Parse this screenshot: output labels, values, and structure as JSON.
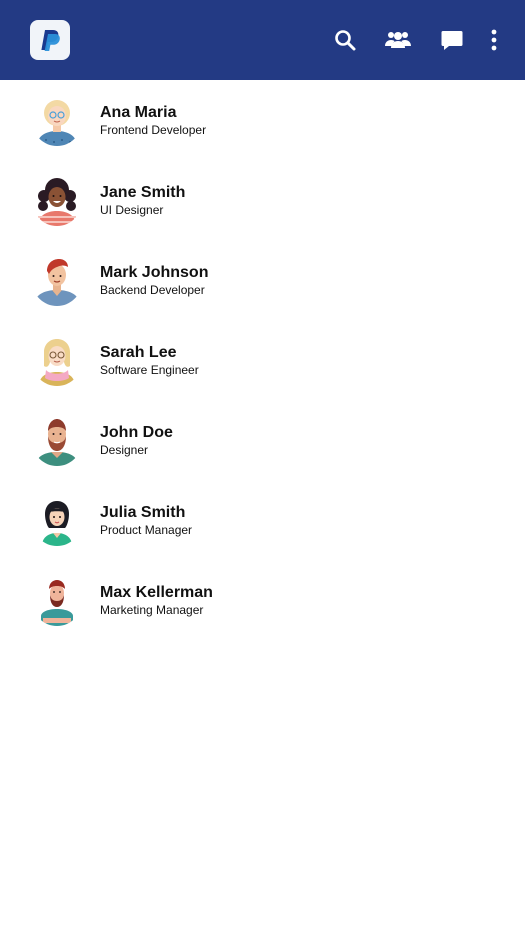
{
  "header": {
    "logo_icon": "paypal-logo-icon",
    "icons": [
      "search-icon",
      "people-icon",
      "chat-icon",
      "more-vert-icon"
    ],
    "background": "#233a84"
  },
  "contacts": [
    {
      "name": "Ana Maria",
      "role": "Frontend Developer",
      "avatar_icon": "avatar-blonde-woman-glasses-icon"
    },
    {
      "name": "Jane Smith",
      "role": "UI Designer",
      "avatar_icon": "avatar-curly-hair-woman-icon"
    },
    {
      "name": "Mark Johnson",
      "role": "Backend Developer",
      "avatar_icon": "avatar-redhead-man-icon"
    },
    {
      "name": "Sarah Lee",
      "role": "Software Engineer",
      "avatar_icon": "avatar-blonde-woman-scarf-icon"
    },
    {
      "name": "John Doe",
      "role": "Designer",
      "avatar_icon": "avatar-bearded-man-icon"
    },
    {
      "name": "Julia Smith",
      "role": "Product Manager",
      "avatar_icon": "avatar-dark-hair-woman-icon"
    },
    {
      "name": "Max Kellerman",
      "role": "Marketing Manager",
      "avatar_icon": "avatar-bearded-man-crossed-arms-icon"
    }
  ]
}
